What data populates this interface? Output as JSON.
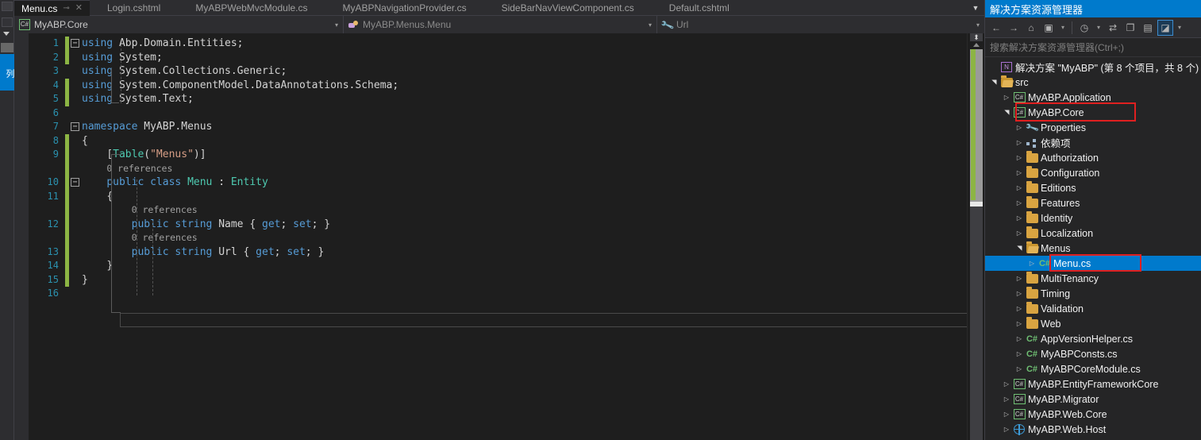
{
  "window": {
    "left_dock_label": "列"
  },
  "tabs": {
    "items": [
      {
        "label": "Menu.cs",
        "active": true,
        "pin": "⊸",
        "close": "✕"
      },
      {
        "label": "Login.cshtml",
        "active": false
      },
      {
        "label": "MyABPWebMvcModule.cs",
        "active": false
      },
      {
        "label": "MyABPNavigationProvider.cs",
        "active": false
      },
      {
        "label": "SideBarNavViewComponent.cs",
        "active": false
      },
      {
        "label": "Default.cshtml",
        "active": false
      }
    ],
    "overflow_icon": "▼"
  },
  "navbar": {
    "project": {
      "icon": "cs-project-icon",
      "icon_text": "C#",
      "label": "MyABP.Core",
      "arrow": "▾"
    },
    "type": {
      "icon": "method-icon",
      "label": "MyABP.Menus.Menu",
      "arrow": "▾"
    },
    "member": {
      "icon": "wrench-icon",
      "label": "Url",
      "arrow": "▾"
    }
  },
  "editor": {
    "lines": [
      {
        "no": "1",
        "changed": true,
        "glyph": "collapse",
        "html": "<span class='k'>using</span> <span class='ns'>Abp.Domain.Entities;</span>"
      },
      {
        "no": "2",
        "changed": true,
        "glyph": "",
        "html": "<span class='k'>using</span> <span class='ns'>System;</span>"
      },
      {
        "no": "3",
        "changed": false,
        "glyph": "",
        "html": "<span class='k'>using</span> <span class='ns'>System.Collections.Generic;</span>"
      },
      {
        "no": "4",
        "changed": true,
        "glyph": "",
        "html": "<span class='k'>using</span> <span class='ns'>System.ComponentModel.DataAnnotations.Schema;</span>"
      },
      {
        "no": "5",
        "changed": true,
        "glyph": "",
        "html": "<span class='k'>using</span> <span class='ns'>System.Text;</span>"
      },
      {
        "no": "6",
        "changed": false,
        "glyph": "",
        "html": ""
      },
      {
        "no": "7",
        "changed": false,
        "glyph": "collapse",
        "html": "<span class='k'>namespace</span> <span class='pl'>MyABP.Menus</span>"
      },
      {
        "no": "8",
        "changed": true,
        "glyph": "",
        "html": "<span class='pl'>{</span>"
      },
      {
        "no": "9",
        "changed": true,
        "glyph": "",
        "html": "    <span class='pl'>[</span><span class='ty'>Table</span><span class='pl'>(</span><span class='str'>\"Menus\"</span><span class='pl'>)]</span>"
      },
      {
        "no": "",
        "changed": true,
        "glyph": "",
        "html": "    <span class='ref'>0 references</span>"
      },
      {
        "no": "10",
        "changed": true,
        "glyph": "collapse",
        "html": "    <span class='k'>public class</span> <span class='ty'>Menu</span> <span class='pl'>:</span> <span class='ty'>Entity</span>"
      },
      {
        "no": "11",
        "changed": true,
        "glyph": "",
        "html": "    <span class='pl'>{</span>"
      },
      {
        "no": "",
        "changed": true,
        "glyph": "",
        "html": "        <span class='ref'>0 references</span>"
      },
      {
        "no": "12",
        "changed": true,
        "glyph": "",
        "html": "        <span class='k'>public string</span> <span class='pl'>Name {</span> <span class='k'>get</span><span class='pl'>;</span> <span class='k'>set</span><span class='pl'>; }</span>"
      },
      {
        "no": "",
        "changed": true,
        "glyph": "",
        "html": "        <span class='ref'>0 references</span>"
      },
      {
        "no": "13",
        "changed": true,
        "glyph": "",
        "html": "        <span class='k'>public string</span> <span class='pl'>Url {</span> <span class='k'>get</span><span class='pl'>;</span> <span class='k'>set</span><span class='pl'>; }</span>"
      },
      {
        "no": "14",
        "changed": true,
        "glyph": "",
        "html": "    <span class='pl'>}</span>"
      },
      {
        "no": "15",
        "changed": true,
        "glyph": "",
        "html": "<span class='pl'>}</span>"
      },
      {
        "no": "16",
        "changed": false,
        "glyph": "",
        "html": ""
      }
    ],
    "scrollbar": {
      "splitter_icon": "split-handle",
      "up_arrow": "▲"
    }
  },
  "solution_explorer": {
    "title": "解决方案资源管理器",
    "toolbar": [
      {
        "name": "back-button",
        "glyph": "←"
      },
      {
        "name": "forward-button",
        "glyph": "→"
      },
      {
        "name": "home-button",
        "glyph": "⌂"
      },
      {
        "name": "show-all-files-button",
        "glyph": "▣"
      },
      {
        "name": "show-all-files-dropdown",
        "glyph": "▾"
      },
      {
        "name": "pending-changes-button",
        "glyph": "◷"
      },
      {
        "name": "pending-changes-dropdown",
        "glyph": "▾"
      },
      {
        "name": "sync-with-active-document-button",
        "glyph": "⇄"
      },
      {
        "name": "refresh-button",
        "glyph": "❐"
      },
      {
        "name": "collapse-all-button",
        "glyph": "▤"
      },
      {
        "name": "properties-button",
        "glyph": "◪"
      },
      {
        "name": "properties-dropdown",
        "glyph": "▾"
      }
    ],
    "search_placeholder": "搜索解决方案资源管理器(Ctrl+;)",
    "tree": [
      {
        "indent": 0,
        "expander": "",
        "icon": "solution-icon",
        "label": "解决方案 \"MyABP\" (第 8 个项目，共 8 个)"
      },
      {
        "indent": 0,
        "expander": "open",
        "icon": "folder-open-icon",
        "label": "src"
      },
      {
        "indent": 1,
        "expander": "closed",
        "icon": "csproj-icon",
        "label": "MyABP.Application"
      },
      {
        "indent": 1,
        "expander": "open",
        "icon": "csproj-icon",
        "label": "MyABP.Core",
        "highlight_red": true
      },
      {
        "indent": 2,
        "expander": "closed",
        "icon": "wrench-icon",
        "label": "Properties"
      },
      {
        "indent": 2,
        "expander": "closed",
        "icon": "dependencies-icon",
        "label": "依赖项"
      },
      {
        "indent": 2,
        "expander": "closed",
        "icon": "folder-icon",
        "label": "Authorization"
      },
      {
        "indent": 2,
        "expander": "closed",
        "icon": "folder-icon",
        "label": "Configuration"
      },
      {
        "indent": 2,
        "expander": "closed",
        "icon": "folder-icon",
        "label": "Editions"
      },
      {
        "indent": 2,
        "expander": "closed",
        "icon": "folder-icon",
        "label": "Features"
      },
      {
        "indent": 2,
        "expander": "closed",
        "icon": "folder-icon",
        "label": "Identity"
      },
      {
        "indent": 2,
        "expander": "closed",
        "icon": "folder-icon",
        "label": "Localization"
      },
      {
        "indent": 2,
        "expander": "open",
        "icon": "folder-open-icon",
        "label": "Menus"
      },
      {
        "indent": 3,
        "expander": "closed",
        "icon": "cs-file-icon",
        "label": "Menu.cs",
        "selected": true,
        "highlight_red": true
      },
      {
        "indent": 2,
        "expander": "closed",
        "icon": "folder-icon",
        "label": "MultiTenancy"
      },
      {
        "indent": 2,
        "expander": "closed",
        "icon": "folder-icon",
        "label": "Timing"
      },
      {
        "indent": 2,
        "expander": "closed",
        "icon": "folder-icon",
        "label": "Validation"
      },
      {
        "indent": 2,
        "expander": "closed",
        "icon": "folder-icon",
        "label": "Web"
      },
      {
        "indent": 2,
        "expander": "closed",
        "icon": "cs-file-icon",
        "label": "AppVersionHelper.cs"
      },
      {
        "indent": 2,
        "expander": "closed",
        "icon": "cs-file-icon",
        "label": "MyABPConsts.cs"
      },
      {
        "indent": 2,
        "expander": "closed",
        "icon": "cs-file-icon",
        "label": "MyABPCoreModule.cs"
      },
      {
        "indent": 1,
        "expander": "closed",
        "icon": "csproj-icon",
        "label": "MyABP.EntityFrameworkCore"
      },
      {
        "indent": 1,
        "expander": "closed",
        "icon": "csproj-icon",
        "label": "MyABP.Migrator"
      },
      {
        "indent": 1,
        "expander": "closed",
        "icon": "csproj-icon",
        "label": "MyABP.Web.Core"
      },
      {
        "indent": 1,
        "expander": "closed",
        "icon": "web-icon",
        "label": "MyABP.Web.Host"
      }
    ]
  },
  "colors": {
    "accent": "#007acc",
    "annotation_red": "#e02020",
    "keyword": "#569cd6",
    "type": "#4ec9b0",
    "string": "#d69d85",
    "line_number": "#2b91af",
    "changed_margin": "#8cb544",
    "editor_bg": "#1e1e1e",
    "panel_bg": "#252526"
  }
}
